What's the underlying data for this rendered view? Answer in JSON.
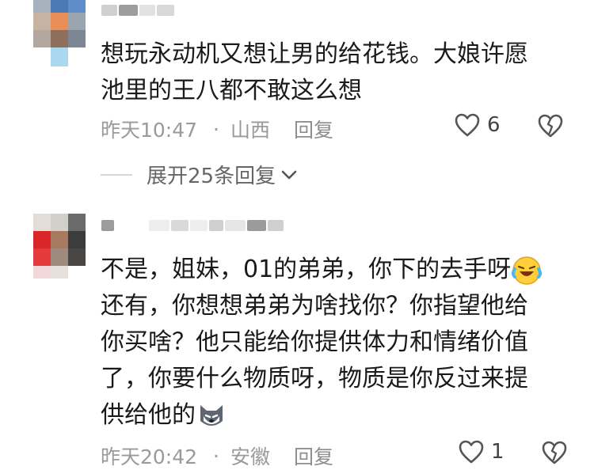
{
  "comments": [
    {
      "text": "想玩永动机又想让男的给花钱。大娘许愿\n池里的王八都不敢这么想",
      "time": "昨天10:47",
      "separator": "·",
      "location": "山西",
      "reply_label": "回复",
      "like_count": "6",
      "expand_label": "展开25条回复"
    },
    {
      "text_line1": "不是，姐妹，01的弟弟，你下的去手呀",
      "text_rest": "\n还有，你想想弟弟为啥找你？你指望他给\n你买啥？他只能给你提供体力和情绪价值\n了，你要什么物质呀，物质是你反过来提\n供给他的",
      "time": "昨天20:42",
      "separator": "·",
      "location": "安徽",
      "reply_label": "回复",
      "like_count": "1"
    }
  ],
  "icons": {
    "like": "heart-outline-icon",
    "dislike": "broken-heart-icon",
    "expand": "chevron-down-icon",
    "emoji1": "laughing-crying-emoji",
    "emoji2": "husky-dog-emoji"
  },
  "colors": {
    "meta": "#9a9a9a",
    "text": "#1a1a1a"
  }
}
